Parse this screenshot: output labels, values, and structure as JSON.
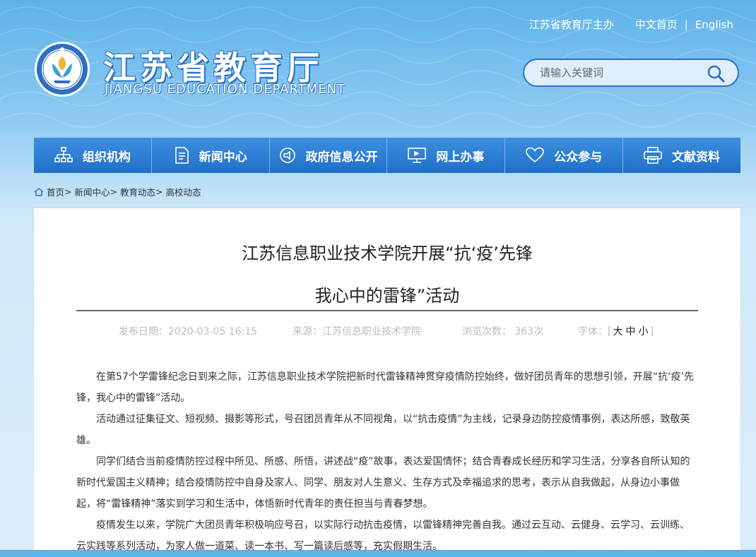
{
  "header": {
    "host_text": "江苏省教育厅主办",
    "home_link": "中文首页",
    "english_link": "English",
    "title_cn": "江苏省教育厅",
    "title_en": "JIANGSU EDUCATION DEPARTMENT",
    "logo_icon": "education-emblem-icon"
  },
  "search": {
    "placeholder": "请输入关键词"
  },
  "nav": [
    {
      "label": "组织机构",
      "icon": "org-chart-icon"
    },
    {
      "label": "新闻中心",
      "icon": "document-icon"
    },
    {
      "label": "政府信息公开",
      "icon": "megaphone-icon"
    },
    {
      "label": "网上办事",
      "icon": "monitor-icon"
    },
    {
      "label": "公众参与",
      "icon": "heart-icon"
    },
    {
      "label": "文献资料",
      "icon": "printer-icon"
    }
  ],
  "breadcrumb": {
    "home": "首页",
    "sep": ">",
    "items": [
      "新闻中心",
      "教育动态",
      "高校动态"
    ]
  },
  "article": {
    "title_line1": "江苏信息职业技术学院开展“抗‘疫’先锋",
    "title_line2": "我心中的雷锋”活动",
    "publish_date": "发布日期：2020-03-05 16:15",
    "source": "来源：江苏信息职业技术学院",
    "views": "浏览次数： 363次",
    "font_label": "字体：[",
    "font_large": "大",
    "font_medium": "中",
    "font_small": "小",
    "font_close": "]",
    "paragraphs": [
      "在第57个学雷锋纪念日到来之际，江苏信息职业技术学院把新时代雷锋精神贯穿疫情防控始终，做好团员青年的思想引领，开展“抗‘疫’先锋，我心中的雷锋”活动。",
      "活动通过征集征文、短视频、摄影等形式，号召团员青年从不同视角，以“抗击疫情”为主线，记录身边防控疫情事例，表达所感，致敬英雄。",
      "同学们结合当前疫情防控过程中所见、所感、所悟，讲述战“疫”故事，表达爱国情怀；结合青春成长经历和学习生活，分享各自所认知的新时代爱国主义精神；结合疫情防控中自身及家人、同学、朋友对人生意义、生存方式及幸福追求的思考，表示从自我做起，从身边小事做起，将“雷锋精神”落实到学习和生活中，体悟新时代青年的责任担当与青春梦想。",
      "疫情发生以来，学院广大团员青年积极响应号召，以实际行动抗击疫情，以雷锋精神完善自我。通过云互动、云健身、云学习、云训练、云实践等系列活动，为家人做一道菜、读一本书、写一篇读后感等，充实假期生活。"
    ]
  }
}
